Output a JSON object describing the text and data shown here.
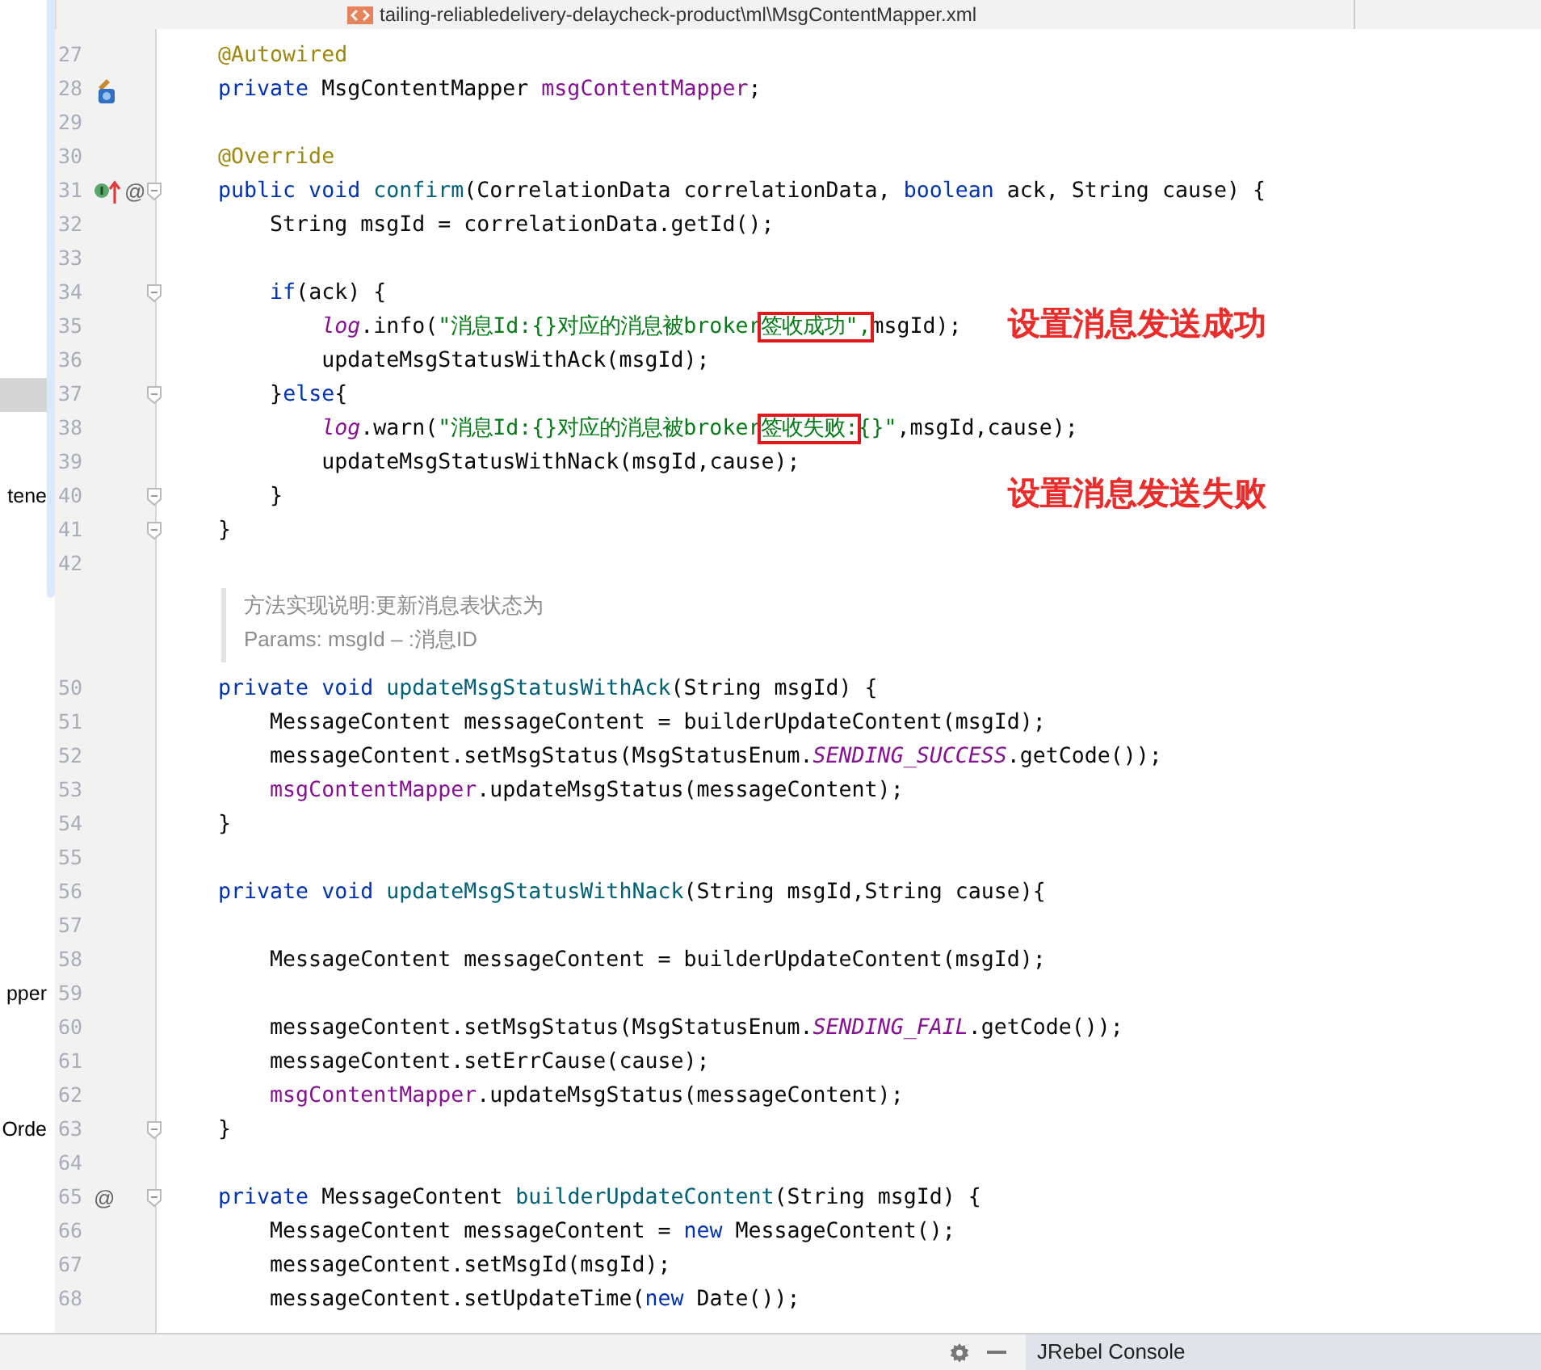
{
  "tab_bar": {
    "file_tab": "tailing-reliabledelivery-delaycheck-product\\ml\\MsgContentMapper.xml"
  },
  "editor": {
    "lines": [
      {
        "kind": "code",
        "n": "27",
        "tokens": [
          {
            "kind": "ann",
            "text": "    @Autowired"
          }
        ]
      },
      {
        "kind": "code",
        "n": "28",
        "gutter_icon": {
          "kind": "bean"
        },
        "tokens": [
          {
            "kind": "kw",
            "text": "    private"
          },
          {
            "kind": "p",
            "text": " MsgContentMapper "
          },
          {
            "kind": "fld",
            "text": "msgContentMapper"
          },
          {
            "kind": "p",
            "text": ";"
          }
        ]
      },
      {
        "kind": "code",
        "n": "29"
      },
      {
        "kind": "code",
        "n": "30",
        "tokens": [
          {
            "kind": "ann",
            "text": "    @Override"
          }
        ]
      },
      {
        "kind": "code",
        "n": "31",
        "gutter_icon": {
          "kind": "implements"
        },
        "gutter_text": "@",
        "fold": true,
        "tokens": [
          {
            "kind": "kw",
            "text": "    public void "
          },
          {
            "kind": "fn",
            "text": "confirm"
          },
          {
            "kind": "p",
            "text": "(CorrelationData correlationData, "
          },
          {
            "kind": "kw",
            "text": "boolean"
          },
          {
            "kind": "p",
            "text": " ack, String cause) {"
          }
        ]
      },
      {
        "kind": "code",
        "n": "32",
        "tokens": [
          {
            "kind": "p",
            "text": "        String msgId = correlationData.getId();"
          }
        ]
      },
      {
        "kind": "code",
        "n": "33"
      },
      {
        "kind": "code",
        "n": "34",
        "fold": true,
        "tokens": [
          {
            "kind": "kw",
            "text": "        if"
          },
          {
            "kind": "p",
            "text": "(ack) {"
          }
        ]
      },
      {
        "kind": "code",
        "n": "35",
        "note": "设置消息发送成功",
        "tokens": [
          {
            "kind": "st",
            "text": "            log"
          },
          {
            "kind": "p",
            "text": ".info("
          },
          {
            "kind": "str",
            "text": "\"消息Id:{}对应的消息被broker"
          },
          {
            "kind": "box",
            "text": "签收成功\","
          },
          {
            "kind": "p",
            "text": "msgId);"
          }
        ]
      },
      {
        "kind": "code",
        "n": "36",
        "tokens": [
          {
            "kind": "p",
            "text": "            updateMsgStatusWithAck(msgId);"
          }
        ]
      },
      {
        "kind": "code",
        "n": "37",
        "fold": true,
        "side": {
          "selected": true
        },
        "tokens": [
          {
            "kind": "p",
            "text": "        }"
          },
          {
            "kind": "kw",
            "text": "else"
          },
          {
            "kind": "p",
            "text": "{"
          }
        ]
      },
      {
        "kind": "code",
        "n": "38",
        "tokens": [
          {
            "kind": "st",
            "text": "            log"
          },
          {
            "kind": "p",
            "text": ".warn("
          },
          {
            "kind": "str",
            "text": "\"消息Id:{}对应的消息被broker"
          },
          {
            "kind": "box",
            "text": "签收失败:"
          },
          {
            "kind": "str",
            "text": "{}\""
          },
          {
            "kind": "p",
            "text": ",msgId,cause);"
          }
        ]
      },
      {
        "kind": "code",
        "n": "39",
        "tokens": [
          {
            "kind": "p",
            "text": "            updateMsgStatusWithNack(msgId,cause);"
          }
        ]
      },
      {
        "kind": "code",
        "n": "40",
        "fold": true,
        "side": {
          "label": "tene",
          "selected": false
        },
        "note": "设置消息发送失败",
        "tokens": [
          {
            "kind": "p",
            "text": "        }"
          }
        ]
      },
      {
        "kind": "code",
        "n": "41",
        "fold": true,
        "tokens": [
          {
            "kind": "p",
            "text": "    }"
          }
        ]
      },
      {
        "kind": "code",
        "n": "42"
      },
      {
        "kind": "doc",
        "text": [
          "方法实现说明:更新消息表状态为",
          "Params: msgId – :消息ID"
        ]
      },
      {
        "kind": "code",
        "n": "50",
        "tokens": [
          {
            "kind": "kw",
            "text": "    private void "
          },
          {
            "kind": "fn",
            "text": "updateMsgStatusWithAck"
          },
          {
            "kind": "p",
            "text": "(String msgId) {"
          }
        ]
      },
      {
        "kind": "code",
        "n": "51",
        "tokens": [
          {
            "kind": "p",
            "text": "        MessageContent messageContent = builderUpdateContent(msgId);"
          }
        ]
      },
      {
        "kind": "code",
        "n": "52",
        "tokens": [
          {
            "kind": "p",
            "text": "        messageContent.setMsgStatus(MsgStatusEnum."
          },
          {
            "kind": "cst",
            "text": "SENDING_SUCCESS"
          },
          {
            "kind": "p",
            "text": ".getCode());"
          }
        ]
      },
      {
        "kind": "code",
        "n": "53",
        "tokens": [
          {
            "kind": "fld",
            "text": "        msgContentMapper"
          },
          {
            "kind": "p",
            "text": ".updateMsgStatus(messageContent);"
          }
        ]
      },
      {
        "kind": "code",
        "n": "54",
        "tokens": [
          {
            "kind": "p",
            "text": "    }"
          }
        ]
      },
      {
        "kind": "code",
        "n": "55"
      },
      {
        "kind": "code",
        "n": "56",
        "tokens": [
          {
            "kind": "kw",
            "text": "    private void "
          },
          {
            "kind": "fn",
            "text": "updateMsgStatusWithNack"
          },
          {
            "kind": "p",
            "text": "(String msgId,String cause){"
          }
        ]
      },
      {
        "kind": "code",
        "n": "57"
      },
      {
        "kind": "code",
        "n": "58",
        "tokens": [
          {
            "kind": "p",
            "text": "        MessageContent messageContent = builderUpdateContent(msgId);"
          }
        ]
      },
      {
        "kind": "code",
        "n": "59",
        "side": {
          "label": "pper",
          "selected": false
        }
      },
      {
        "kind": "code",
        "n": "60",
        "tokens": [
          {
            "kind": "p",
            "text": "        messageContent.setMsgStatus(MsgStatusEnum."
          },
          {
            "kind": "cst",
            "text": "SENDING_FAIL"
          },
          {
            "kind": "p",
            "text": ".getCode());"
          }
        ]
      },
      {
        "kind": "code",
        "n": "61",
        "tokens": [
          {
            "kind": "p",
            "text": "        messageContent.setErrCause(cause);"
          }
        ]
      },
      {
        "kind": "code",
        "n": "62",
        "tokens": [
          {
            "kind": "fld",
            "text": "        msgContentMapper"
          },
          {
            "kind": "p",
            "text": ".updateMsgStatus(messageContent);"
          }
        ]
      },
      {
        "kind": "code",
        "n": "63",
        "fold": true,
        "side": {
          "label": "Orde",
          "selected": false
        },
        "tokens": [
          {
            "kind": "p",
            "text": "    }"
          }
        ]
      },
      {
        "kind": "code",
        "n": "64"
      },
      {
        "kind": "code",
        "n": "65",
        "gutter_text": "@",
        "fold": true,
        "tokens": [
          {
            "kind": "kw",
            "text": "    private "
          },
          {
            "kind": "p",
            "text": "MessageContent "
          },
          {
            "kind": "fn",
            "text": "builderUpdateContent"
          },
          {
            "kind": "p",
            "text": "(String msgId) {"
          }
        ]
      },
      {
        "kind": "code",
        "n": "66",
        "tokens": [
          {
            "kind": "p",
            "text": "        MessageContent messageContent = "
          },
          {
            "kind": "kw",
            "text": "new "
          },
          {
            "kind": "p",
            "text": "MessageContent();"
          }
        ]
      },
      {
        "kind": "code",
        "n": "67",
        "tokens": [
          {
            "kind": "p",
            "text": "        messageContent.setMsgId(msgId);"
          }
        ]
      },
      {
        "kind": "code",
        "n": "68",
        "tokens": [
          {
            "kind": "p",
            "text": "        messageContent.setUpdateTime("
          },
          {
            "kind": "kw",
            "text": "new "
          },
          {
            "kind": "p",
            "text": "Date());"
          }
        ]
      }
    ]
  },
  "bottom_bar": {
    "console_tab": "JRebel Console"
  }
}
